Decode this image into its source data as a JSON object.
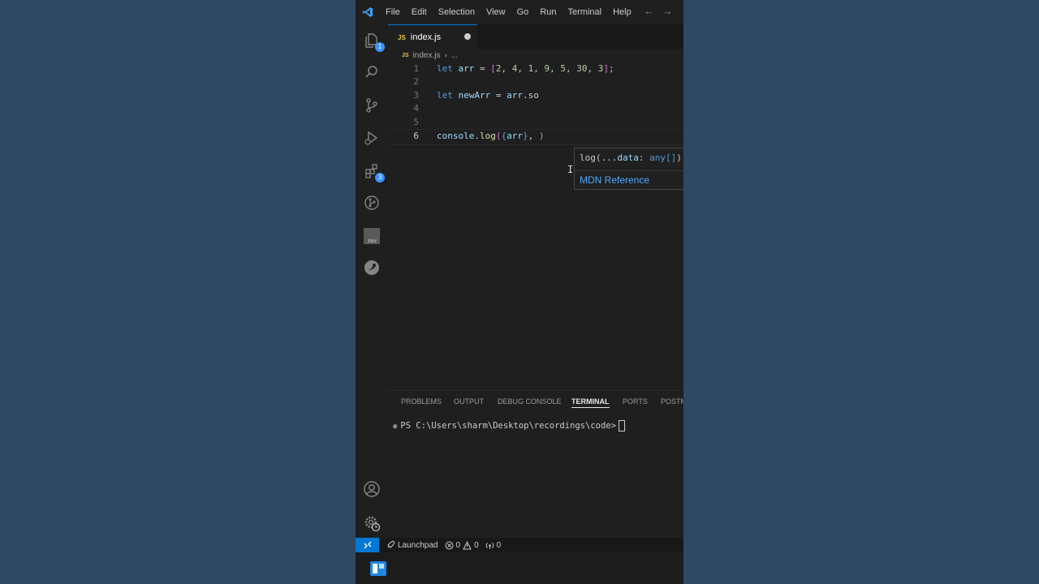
{
  "menu": [
    "File",
    "Edit",
    "Selection",
    "View",
    "Go",
    "Run",
    "Terminal",
    "Help"
  ],
  "activity_bar": {
    "explorer_badge": "1",
    "extensions_badge": "3",
    "env_label": ".ENV"
  },
  "tab": {
    "badge": "JS",
    "name": "index.js"
  },
  "breadcrumbs": {
    "file": "index.js",
    "sep": "›",
    "more": "..."
  },
  "editor": {
    "lines": [
      {
        "num": "1",
        "tokens": [
          {
            "t": "let ",
            "c": "kw"
          },
          {
            "t": "arr",
            "c": "var"
          },
          {
            "t": " = ",
            "c": ""
          },
          {
            "t": "[",
            "c": "br"
          },
          {
            "t": "2",
            "c": "num"
          },
          {
            "t": ", ",
            "c": ""
          },
          {
            "t": "4",
            "c": "num"
          },
          {
            "t": ", ",
            "c": ""
          },
          {
            "t": "1",
            "c": "num"
          },
          {
            "t": ", ",
            "c": ""
          },
          {
            "t": "9",
            "c": "num"
          },
          {
            "t": ", ",
            "c": ""
          },
          {
            "t": "5",
            "c": "num"
          },
          {
            "t": ", ",
            "c": ""
          },
          {
            "t": "30",
            "c": "num"
          },
          {
            "t": ", ",
            "c": ""
          },
          {
            "t": "3",
            "c": "num"
          },
          {
            "t": "]",
            "c": "br"
          },
          {
            "t": ";",
            "c": ""
          }
        ]
      },
      {
        "num": "2",
        "tokens": []
      },
      {
        "num": "3",
        "tokens": [
          {
            "t": "let ",
            "c": "kw"
          },
          {
            "t": "newArr",
            "c": "var"
          },
          {
            "t": " = ",
            "c": ""
          },
          {
            "t": "arr",
            "c": "var"
          },
          {
            "t": ".so",
            "c": ""
          }
        ]
      },
      {
        "num": "4",
        "tokens": []
      },
      {
        "num": "5",
        "tokens": []
      },
      {
        "num": "6",
        "tokens": [
          {
            "t": "console",
            "c": "var"
          },
          {
            "t": ".",
            "c": ""
          },
          {
            "t": "log",
            "c": "fn"
          },
          {
            "t": "(",
            "c": "br"
          },
          {
            "t": "{",
            "c": "kw"
          },
          {
            "t": "arr",
            "c": "var"
          },
          {
            "t": "}",
            "c": "kw"
          },
          {
            "t": ", ",
            "c": ""
          },
          {
            "t": ")",
            "c": "br"
          }
        ]
      }
    ],
    "active_line": "6"
  },
  "hover": {
    "sig_name": "log(",
    "sig_param": "...data",
    "sig_colon": ": ",
    "sig_type": "any[]",
    "sig_rest": "): void",
    "link": "MDN Reference"
  },
  "panel": {
    "tabs": [
      "PROBLEMS",
      "OUTPUT",
      "DEBUG CONSOLE",
      "TERMINAL",
      "PORTS",
      "POSTMAN"
    ],
    "active_tab": "TERMINAL",
    "terminal_prompt": "PS C:\\Users\\sharm\\Desktop\\recordings\\code>"
  },
  "statusbar": {
    "launchpad": "Launchpad",
    "errors": "0",
    "warnings": "0",
    "ports": "0"
  },
  "colors": {
    "accent": "#0078d4",
    "badge": "#3794ff",
    "link": "#4daafc",
    "background": "#2e4a62"
  }
}
